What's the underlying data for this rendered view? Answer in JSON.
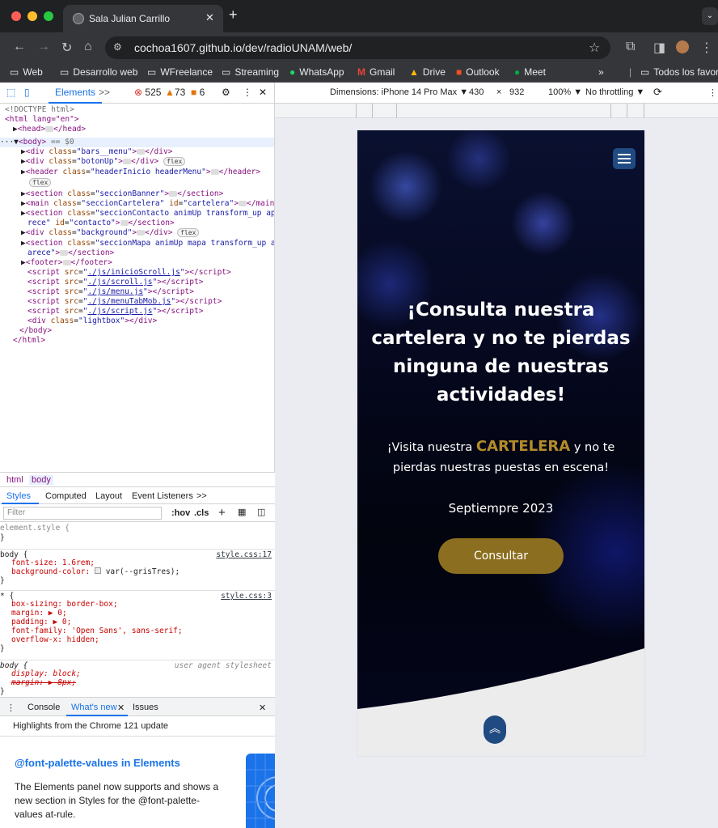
{
  "browser": {
    "tab_title": "Sala Julian Carrillo",
    "tab_close": "✕",
    "new_tab": "+",
    "url": "cochoa1607.github.io/dev/radioUNAM/web/",
    "bookmarks": [
      "Web",
      "Desarrollo web",
      "WFreelance",
      "Streaming",
      "WhatsApp",
      "Gmail",
      "Drive",
      "Outlook",
      "Meet"
    ],
    "bookmarks_more": "»",
    "all_bookmarks": "Todos los favoritos"
  },
  "devtools": {
    "tab_elements": "Elements",
    "more_tabs": ">>",
    "errors": "525",
    "warnings": "73",
    "issues": "6",
    "dom": {
      "doctype": "<!DOCTYPE html>",
      "html_open": "<html lang=\"en\">",
      "head": "<head>",
      "head_close": "</head>",
      "body": "<body>",
      "body_marker": "== $0",
      "div_bars": "bars__menu",
      "div_boton": "botonUp",
      "header": "headerInicio headerMenu",
      "section_banner": "seccionBanner",
      "main_class": "seccionCartelera",
      "main_id": "cartelera",
      "section_contacto": "seccionContacto animUp transform_up apa",
      "section_contacto_cont": "rece",
      "section_contacto_id": "contacto",
      "div_background": "background",
      "section_mapa": "seccionMapa animUp mapa transform_up ap",
      "section_mapa_cont": "arece",
      "footer": "<footer>",
      "scripts": [
        "./js/inicioScroll.js",
        "./js/scroll.js",
        "./js/menu.js",
        "./js/menuTabMob.js",
        "./js/script.js"
      ],
      "lightbox": "lightbox",
      "body_close": "</body>",
      "html_close": "</html>",
      "flex": "flex"
    },
    "breadcrumb": [
      "html",
      "body"
    ],
    "style_tabs": [
      "Styles",
      "Computed",
      "Layout",
      "Event Listeners",
      ">>"
    ],
    "filter_placeholder": "Filter",
    "filter_hov": ":hov",
    "filter_cls": ".cls",
    "rules": {
      "element_style": "element.style {",
      "body_sel": "body {",
      "body_src": "style.css:17",
      "body_p1": "font-size: 1.6rem;",
      "body_p2": "background-color: ",
      "body_p2_val": "var(--grisTres);",
      "star_sel": "* {",
      "star_src": "style.css:3",
      "star_p1": "box-sizing: border-box;",
      "star_p2": "margin: ▶ 0;",
      "star_p3": "padding: ▶ 0;",
      "star_p4": "font-family: 'Open Sans', sans-serif;",
      "star_p5": "overflow-x: hidden;",
      "ua_sel": "body {",
      "ua_src": "user agent stylesheet",
      "ua_p1": "display: block;",
      "ua_p2": "margin: ▶ 8px;",
      "close": "}"
    },
    "drawer_tabs": [
      "Console",
      "What's new",
      "Issues"
    ],
    "whats_new_sub": "Highlights from the Chrome 121 update",
    "whats_new_heading": "@font-palette-values in Elements",
    "whats_new_body": "The Elements panel now supports and shows a new section in Styles for the @font-palette-values at-rule.",
    "emulation": {
      "dimensions": "Dimensions: iPhone 14 Pro Max ▼",
      "width": "430",
      "times": "×",
      "height": "932",
      "zoom": "100% ▼",
      "throttle": "No throttling ▼"
    }
  },
  "page": {
    "heading": "¡Consulta nuestra cartelera y no te pierdas ninguna de nuestras actividades!",
    "sub_before": "¡Visita nuestra ",
    "sub_highlight": "CARTELERA",
    "sub_after": " y no te pierdas nuestras puestas en escena!",
    "date": "Septiempre 2023",
    "button": "Consultar",
    "accent": "#8b6e1f",
    "brand_blue": "#1f4a82"
  }
}
